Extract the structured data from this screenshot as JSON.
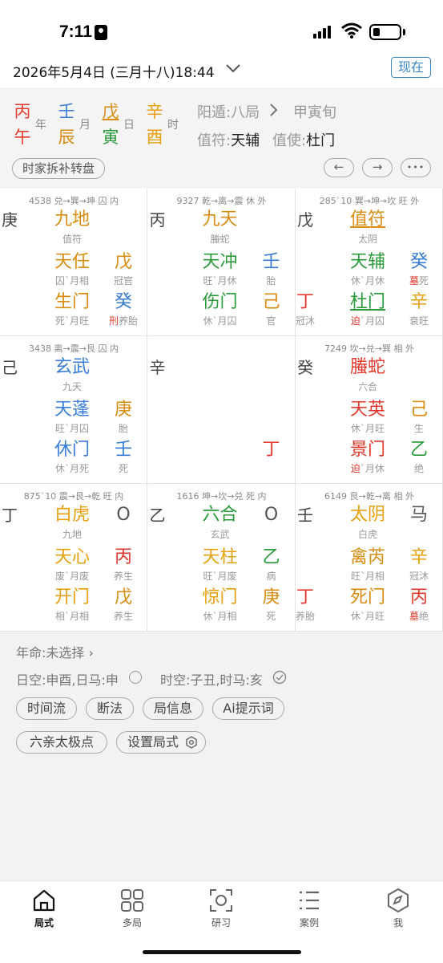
{
  "status": {
    "time": "7:11"
  },
  "datebar": {
    "date": "2026年5月4日 (三月十八)18:44",
    "now": "现在"
  },
  "pillars": [
    {
      "stem": "丙",
      "branch": "午",
      "label": "年",
      "stem_color": "#e23a2d",
      "branch_color": "#e23a2d"
    },
    {
      "stem": "壬",
      "branch": "辰",
      "label": "月",
      "stem_color": "#3a7dd8",
      "branch_color": "#d98c12"
    },
    {
      "stem": "戊",
      "branch": "寅",
      "label": "日",
      "stem_color": "#d98c12",
      "branch_color": "#2a9a3a"
    },
    {
      "stem": "辛",
      "branch": "酉",
      "label": "时",
      "stem_color": "#e8a00c",
      "branch_color": "#e8a00c"
    }
  ],
  "header": {
    "dun": "阳遁:八局",
    "xun": "甲寅旬",
    "zhifu_label": "值符:",
    "zhifu": "天辅",
    "zhishi_label": "值使:",
    "zhishi": "杜门",
    "chip": "时家拆补转盘",
    "prev": "←",
    "next": "→",
    "more": "•••"
  },
  "colors": {
    "red": "#e23a2d",
    "blue": "#3a7dd8",
    "orange": "#d98c12",
    "green": "#2a9a3a",
    "gold": "#e8a00c"
  },
  "palaces": [
    {
      "info": "4538 兑→巽→坤 囚 内",
      "outer": "庚",
      "top": "九地",
      "top_sub": "值符",
      "star": "天任",
      "star_sub": "囚`月相",
      "stem1": "戊",
      "stem1_sub": "冠官",
      "door": "生门",
      "door_sub": "死`月旺",
      "stem2": "癸",
      "stem2_sub_a": "刑",
      "stem2_sub_b": "养胎"
    },
    {
      "info": "9327 乾→离→震 休 外",
      "outer": "丙",
      "top": "九天",
      "top_sub": "螣蛇",
      "star": "天冲",
      "star_sub": "旺`月休",
      "stem1": "壬",
      "stem1_sub": "胎",
      "door": "伤门",
      "door_sub": "休`月囚",
      "stem2": "己",
      "stem2_sub": "官"
    },
    {
      "info": "285`10 巽→坤→坎 旺 外",
      "outer": "戊",
      "top": "值符",
      "top_sub": "太阴",
      "star": "天辅",
      "star_sub": "休`月休",
      "stem1": "癸",
      "stem1_sub_a": "墓",
      "stem1_sub_b": "死",
      "left": "丁",
      "left_sub": "冠沐",
      "door": "杜门",
      "door_sub_a": "迫",
      "door_sub_b": "`月囚",
      "stem2": "辛",
      "stem2_sub": "衰旺"
    },
    {
      "info": "3438 离→震→艮 囚 内",
      "outer": "己",
      "top": "玄武",
      "top_sub": "九天",
      "star": "天蓬",
      "star_sub": "旺`月囚",
      "stem1": "庚",
      "stem1_sub": "胎",
      "door": "休门",
      "door_sub": "休`月死",
      "stem2": "壬",
      "stem2_sub": "死"
    },
    {
      "outer": "辛",
      "stem2": "丁"
    },
    {
      "info": "7249 坎→兑→巽 相 外",
      "outer": "癸",
      "top": "螣蛇",
      "top_sub": "六合",
      "star": "天英",
      "star_sub": "休`月旺",
      "stem1": "己",
      "stem1_sub": "生",
      "door": "景门",
      "door_sub_a": "迫",
      "door_sub_b": "`月休",
      "stem2": "乙",
      "stem2_sub": "绝"
    },
    {
      "info": "875`10 震→艮→乾 旺 内",
      "outer": "丁",
      "top": "白虎",
      "top_sub": "九地",
      "top_right": "O",
      "star": "天心",
      "star_sub": "废`月废",
      "stem1": "丙",
      "stem1_sub": "养生",
      "door": "开门",
      "door_sub": "相`月相",
      "stem2": "戊",
      "stem2_sub": "养生"
    },
    {
      "info": "1616 坤→坎→兑 死 内",
      "outer": "乙",
      "top": "六合",
      "top_sub": "玄武",
      "top_right": "O",
      "star": "天柱",
      "star_sub": "旺`月废",
      "stem1": "乙",
      "stem1_sub": "病",
      "door": "惊门",
      "door_sub": "休`月相",
      "stem2": "庚",
      "stem2_sub": "死"
    },
    {
      "info": "6149 艮→乾→离 相 外",
      "outer": "壬",
      "top": "太阴",
      "top_sub": "白虎",
      "top_right": "马",
      "star": "禽芮",
      "star_sub": "旺`月相",
      "stem1": "辛",
      "stem1_sub": "冠沐",
      "left": "丁",
      "left_sub": "养胎",
      "door": "死门",
      "door_sub": "休`月旺",
      "stem2": "丙",
      "stem2_sub_a": "墓",
      "stem2_sub_b": "绝"
    }
  ],
  "tail": {
    "nianming": "年命:未选择 ›",
    "rikong": "日空:申酉,日马:申",
    "shikong": "时空:子丑,时马:亥",
    "tags": [
      "时间流",
      "断法",
      "局信息",
      "Ai提示词",
      "六亲太极点",
      "设置局式"
    ]
  },
  "tabs": [
    {
      "label": "局式",
      "icon": "home-icon"
    },
    {
      "label": "多局",
      "icon": "grid-icon"
    },
    {
      "label": "研习",
      "icon": "scan-icon"
    },
    {
      "label": "案例",
      "icon": "list-icon"
    },
    {
      "label": "我",
      "icon": "compass-icon"
    }
  ]
}
